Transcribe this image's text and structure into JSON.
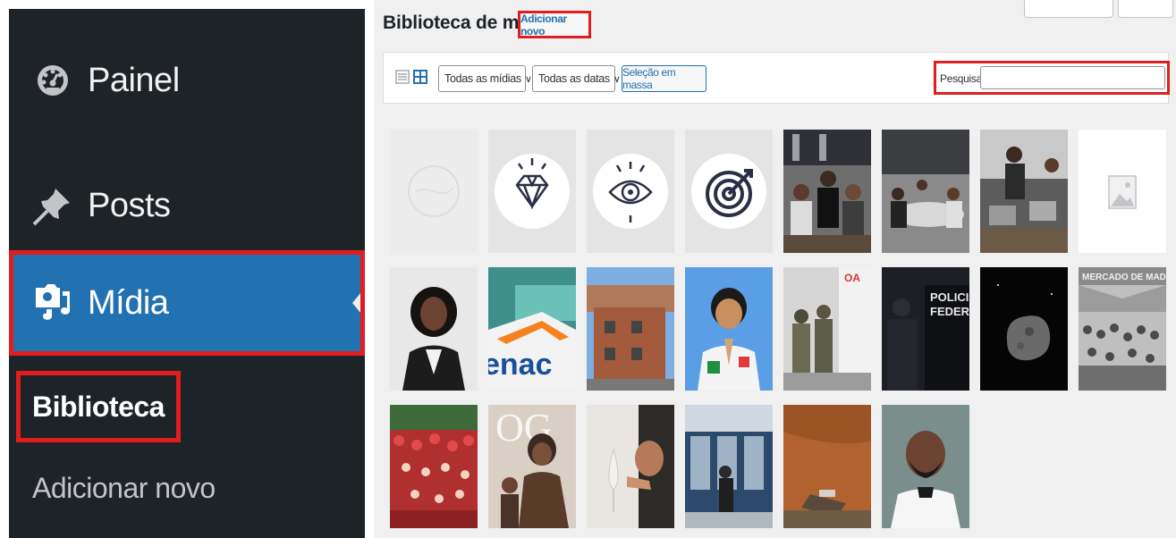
{
  "sidebar": {
    "items": [
      {
        "label": "Painel",
        "icon": "dashboard-icon"
      },
      {
        "label": "Posts",
        "icon": "pushpin-icon"
      },
      {
        "label": "Mídia",
        "icon": "media-icon"
      }
    ],
    "submenu": [
      "Biblioteca",
      "Adicionar novo"
    ]
  },
  "header": {
    "title": "Biblioteca de mídia",
    "add_new": "Adicionar novo"
  },
  "toolbar": {
    "filter_type": "Todas as mídias",
    "filter_date": "Todas as datas",
    "bulk_select": "Seleção em massa",
    "search_label": "Pesquisar",
    "search_value": ""
  },
  "colors": {
    "sidebar_bg": "#1d2327",
    "active_bg": "#2271b1",
    "highlight": "#e01e1e",
    "link": "#2271b1"
  },
  "media_grid": [
    {
      "type": "image",
      "subject": "faded-logo"
    },
    {
      "type": "image",
      "subject": "diamond-icon"
    },
    {
      "type": "image",
      "subject": "eye-icon"
    },
    {
      "type": "image",
      "subject": "target-icon"
    },
    {
      "type": "image",
      "subject": "office-team-high-five"
    },
    {
      "type": "image",
      "subject": "meeting-room"
    },
    {
      "type": "image",
      "subject": "office-laptops"
    },
    {
      "type": "placeholder",
      "subject": "image-placeholder-icon"
    },
    {
      "type": "image",
      "subject": "woman-portrait"
    },
    {
      "type": "image",
      "subject": "enac-card"
    },
    {
      "type": "image",
      "subject": "favela-houses"
    },
    {
      "type": "image",
      "subject": "boy-praying"
    },
    {
      "type": "image",
      "subject": "soldiers-building"
    },
    {
      "type": "image",
      "subject": "policia-federal"
    },
    {
      "type": "image",
      "subject": "asteroid"
    },
    {
      "type": "image",
      "subject": "mercado-de-madureira"
    },
    {
      "type": "image",
      "subject": "carnival-crowd"
    },
    {
      "type": "image",
      "subject": "magazine-cover"
    },
    {
      "type": "image",
      "subject": "woman-drinking-wine"
    },
    {
      "type": "image",
      "subject": "atm-machines"
    },
    {
      "type": "image",
      "subject": "muddy-river"
    },
    {
      "type": "image",
      "subject": "footballer-portrait"
    }
  ]
}
